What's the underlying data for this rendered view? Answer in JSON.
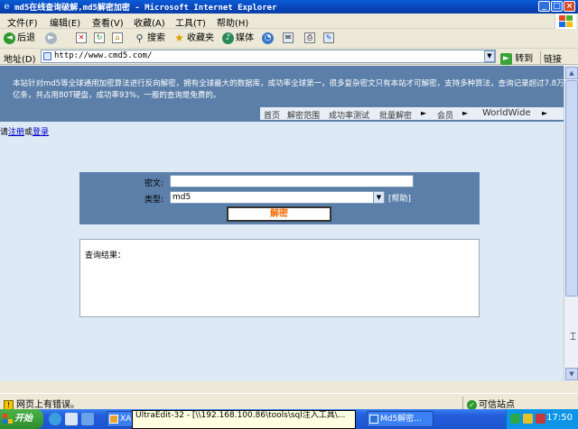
{
  "window": {
    "title": "md5在线查询破解,md5解密加密 - Microsoft Internet Explorer",
    "controls": [
      "_",
      "□",
      "×"
    ]
  },
  "menu": [
    "文件(F)",
    "编辑(E)",
    "查看(V)",
    "收藏(A)",
    "工具(T)",
    "帮助(H)"
  ],
  "toolbar": {
    "back": "后退",
    "search": "搜索",
    "favorites": "收藏夹",
    "media": "媒体"
  },
  "address": {
    "label": "地址(D)",
    "url": "http://www.cmd5.com/",
    "go": "转到",
    "links": "链接"
  },
  "site": {
    "intro": "本站针对md5等全球通用加密算法进行反向解密，拥有全球最大的数据库，成功率全球第一，很多复杂密文只有本站才可解密，支持多种算法，查询记录超过7.8万亿条，共占用80T硬盘，成功率93%，一般的查询是免费的。",
    "nav": [
      "首页",
      "解密范围",
      "成功率测试",
      "批量解密",
      "会员",
      "WorldWide"
    ],
    "reg_prefix": "请",
    "register": "注册",
    "or": "或",
    "login": "登录",
    "form": {
      "cipher_label": "密文:",
      "cipher_value": "",
      "type_label": "类型:",
      "type_value": "md5",
      "help": "[帮助]",
      "submit": "解密"
    },
    "result_label": "查询结果："
  },
  "status": {
    "text": "网页上有错误。",
    "zone": "可信站点"
  },
  "taskbar": {
    "start": "开始",
    "tasks": [
      "XA",
      "UltraEdit-32 - [\\\\192.168.100.86\\tools\\sql注入工具\\...",
      "Md5解密..."
    ],
    "clock": "17:50"
  },
  "colors": {
    "banner": "#5b7fa9",
    "page_bg": "#dde9f5",
    "submit_text": "#ff6a00",
    "link": "#0000cc"
  }
}
